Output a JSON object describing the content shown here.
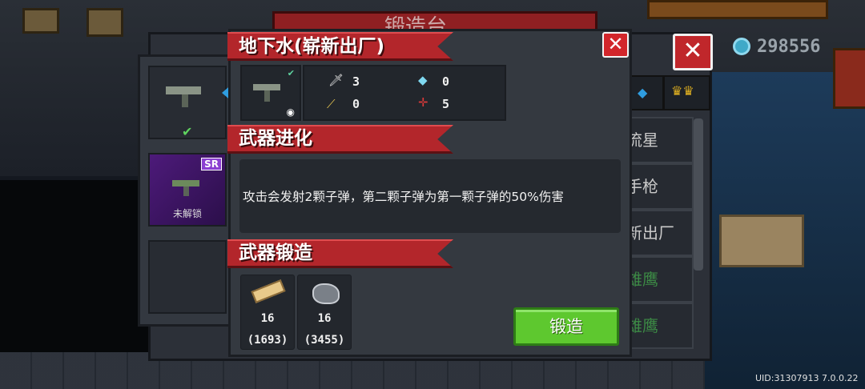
{
  "background": {
    "title": "锻造台",
    "currency_value": "298556",
    "list_items": [
      "流星",
      "手枪",
      "新出厂",
      "雄鹰",
      "雄鹰"
    ]
  },
  "side_slots": {
    "sr_badge": "SR",
    "locked_label": "未解锁"
  },
  "dialog": {
    "weapon_title": "地下水(崭新出厂)",
    "stats": {
      "attack": "3",
      "energy": "0",
      "critical": "0",
      "spread": "5"
    },
    "evolution_title": "武器进化",
    "evolution_desc": "攻击会发射2颗子弹，第二颗子弹为第一颗子弹的50%伤害",
    "forge_title": "武器锻造",
    "materials": [
      {
        "name": "wood-plank-icon",
        "need": "16",
        "owned": "(1693)"
      },
      {
        "name": "iron-ore-icon",
        "need": "16",
        "owned": "(3455)"
      }
    ],
    "forge_button": "锻造",
    "close_label": "✕"
  },
  "footer": {
    "uid": "UID:31307913 7.0.0.22"
  },
  "colors": {
    "ribbon_red": "#b3262b",
    "forge_green": "#5ec82f",
    "gem_blue": "#3fa9c8"
  }
}
